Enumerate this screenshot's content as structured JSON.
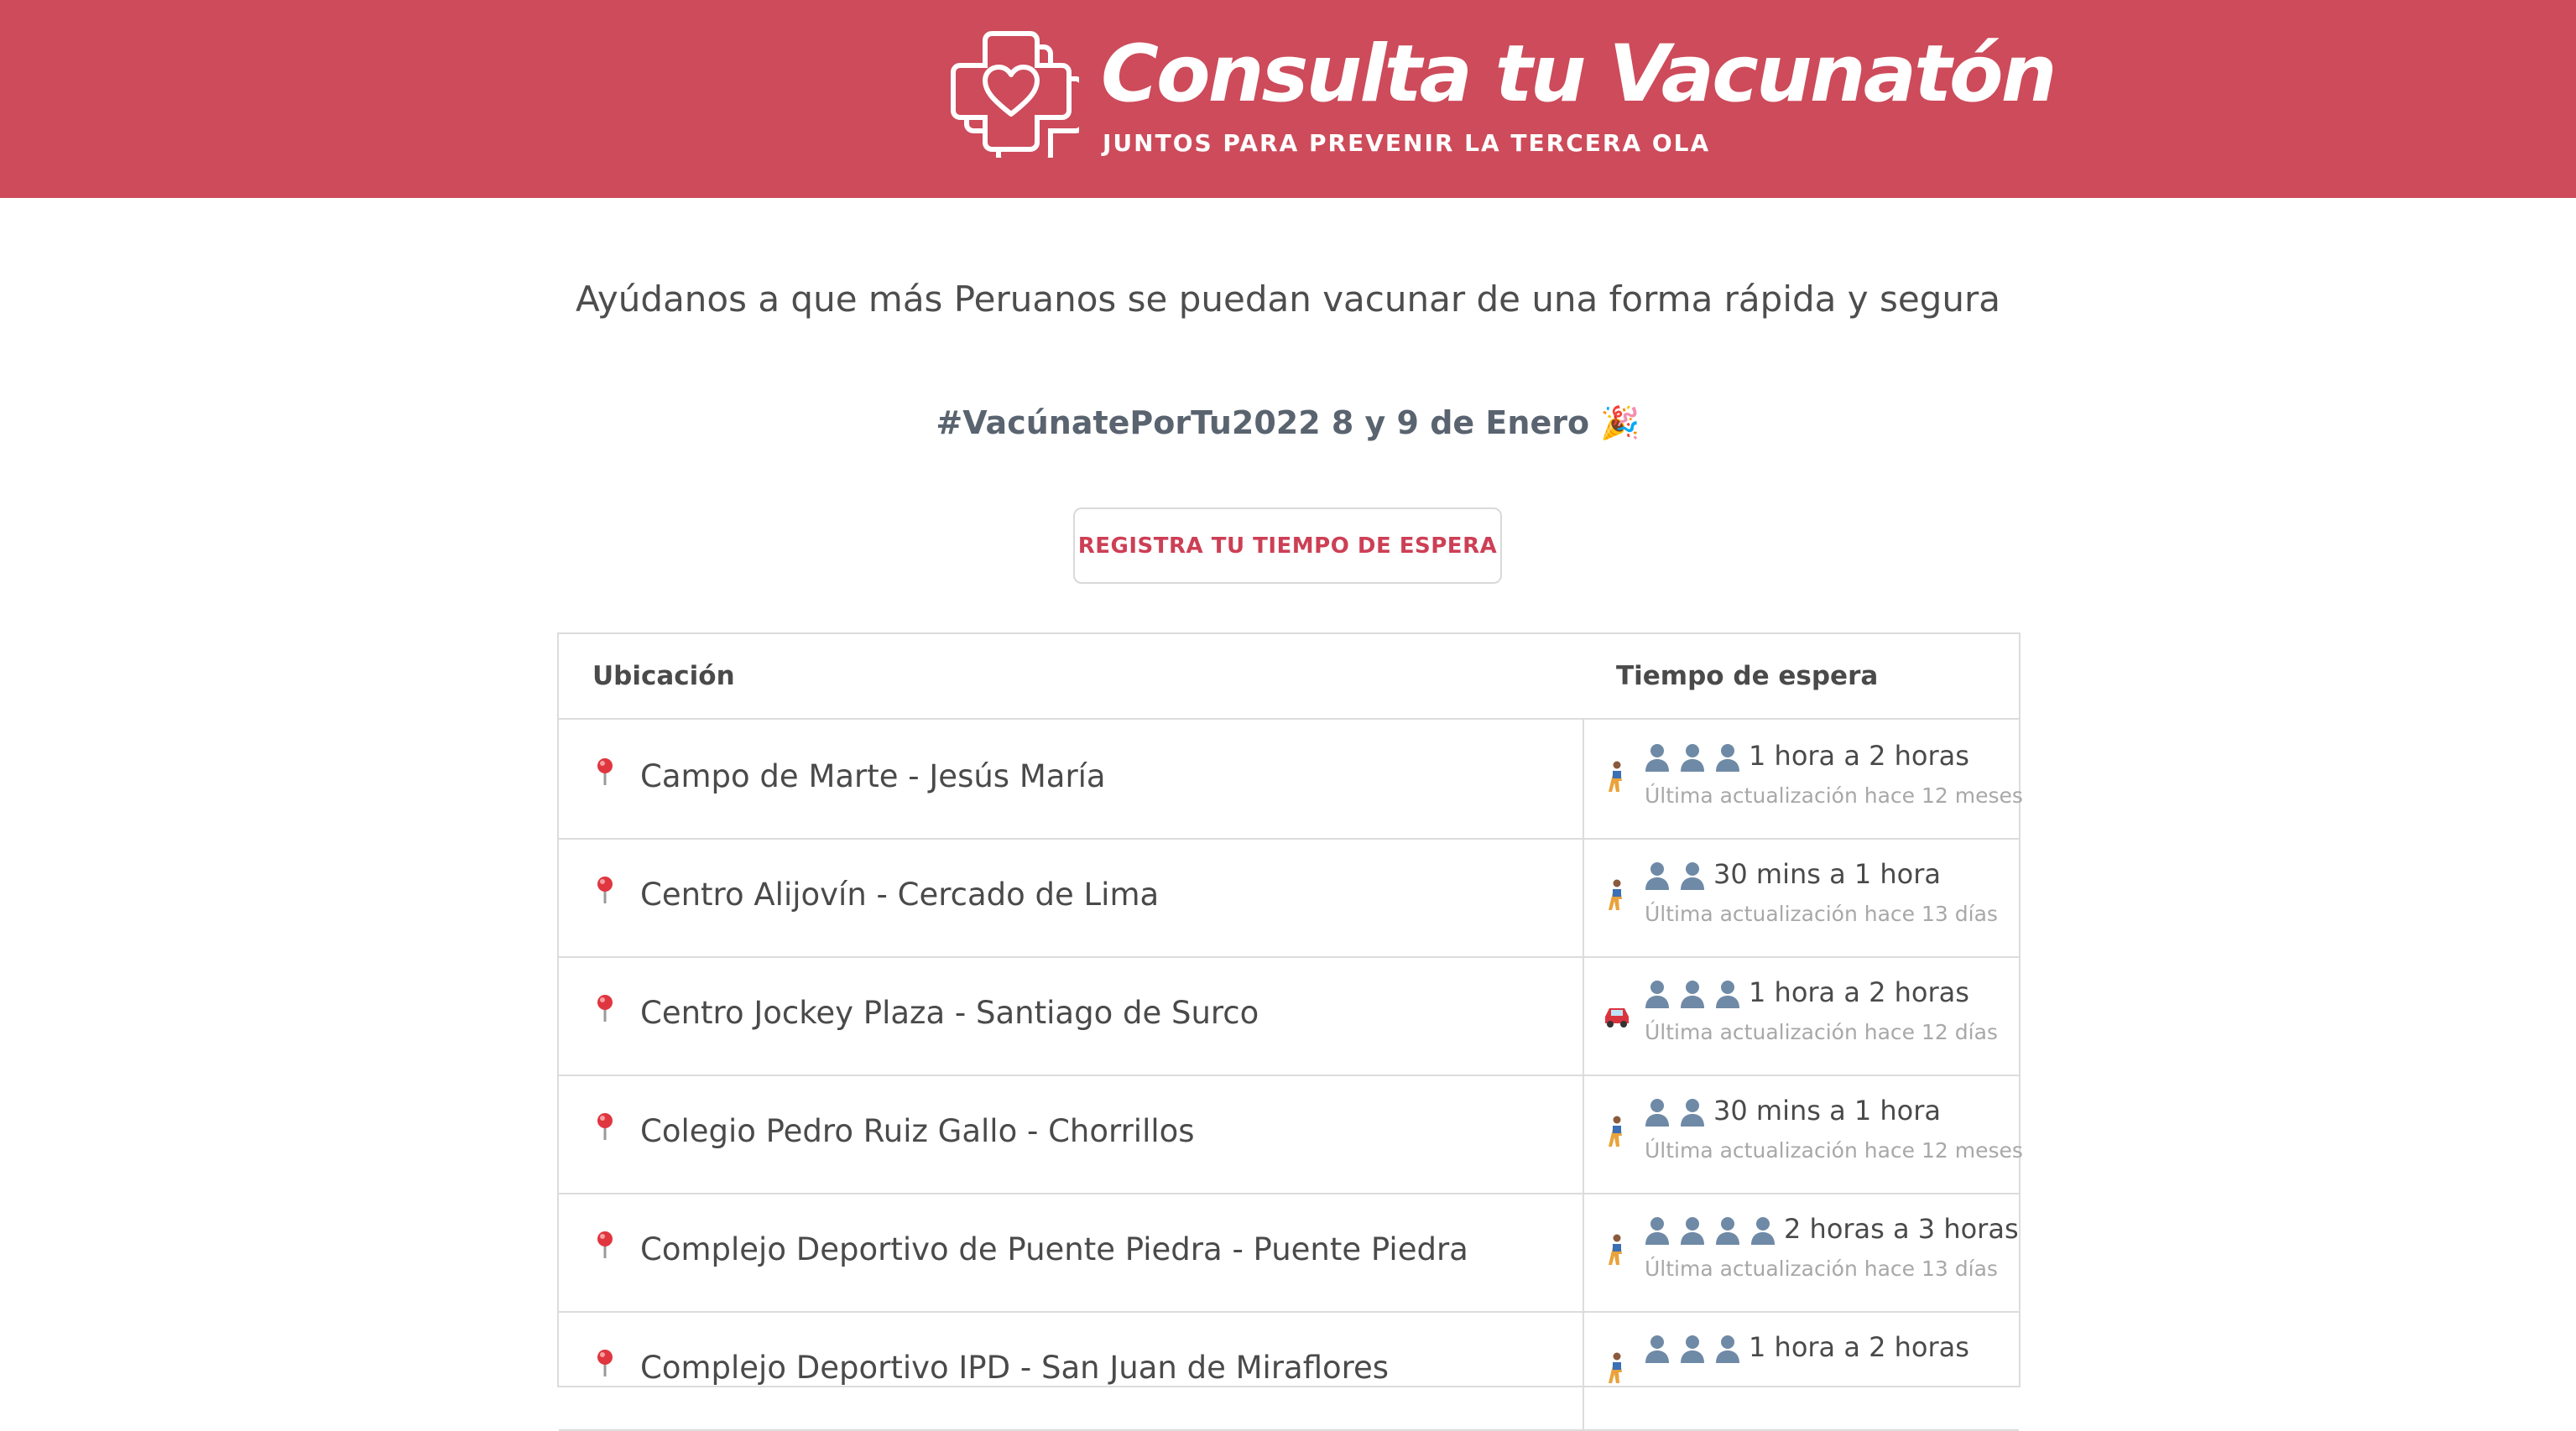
{
  "header": {
    "title": "Consulta tu Vacunatón",
    "subtitle": "JUNTOS PARA PREVENIR LA TERCERA OLA",
    "bg_color": "#cd4b5a",
    "logo_icon": "heart-cross-icon"
  },
  "tagline": "Ayúdanos a que más Peruanos se puedan vacunar de una forma rápida y segura",
  "hashtag": "#VacúnatePorTu2022 8 y 9 de Enero 🎉",
  "register_button": "REGISTRA TU TIEMPO DE ESPERA",
  "table": {
    "headers": {
      "location": "Ubicación",
      "wait_time": "Tiempo de espera"
    },
    "rows": [
      {
        "location": "Campo de Marte - Jesús María",
        "mode": "walking",
        "people": 3,
        "wait": "1 hora a 2 horas",
        "updated": "Última actualización hace 12 meses"
      },
      {
        "location": "Centro Alijovín - Cercado de Lima",
        "mode": "walking",
        "people": 2,
        "wait": "30 mins a 1 hora",
        "updated": "Última actualización hace 13 días"
      },
      {
        "location": "Centro Jockey Plaza - Santiago de Surco",
        "mode": "car",
        "people": 3,
        "wait": "1 hora a 2 horas",
        "updated": "Última actualización hace 12 días"
      },
      {
        "location": "Colegio Pedro Ruiz Gallo - Chorrillos",
        "mode": "walking",
        "people": 2,
        "wait": "30 mins a 1 hora",
        "updated": "Última actualización hace 12 meses"
      },
      {
        "location": "Complejo Deportivo de Puente Piedra - Puente Piedra",
        "mode": "walking",
        "people": 4,
        "wait": "2 horas a 3 horas",
        "updated": "Última actualización hace 13 días"
      },
      {
        "location": "Complejo Deportivo IPD - San Juan de Miraflores",
        "mode": "walking",
        "people": 3,
        "wait": "1 hora a 2 horas",
        "updated": ""
      }
    ]
  }
}
